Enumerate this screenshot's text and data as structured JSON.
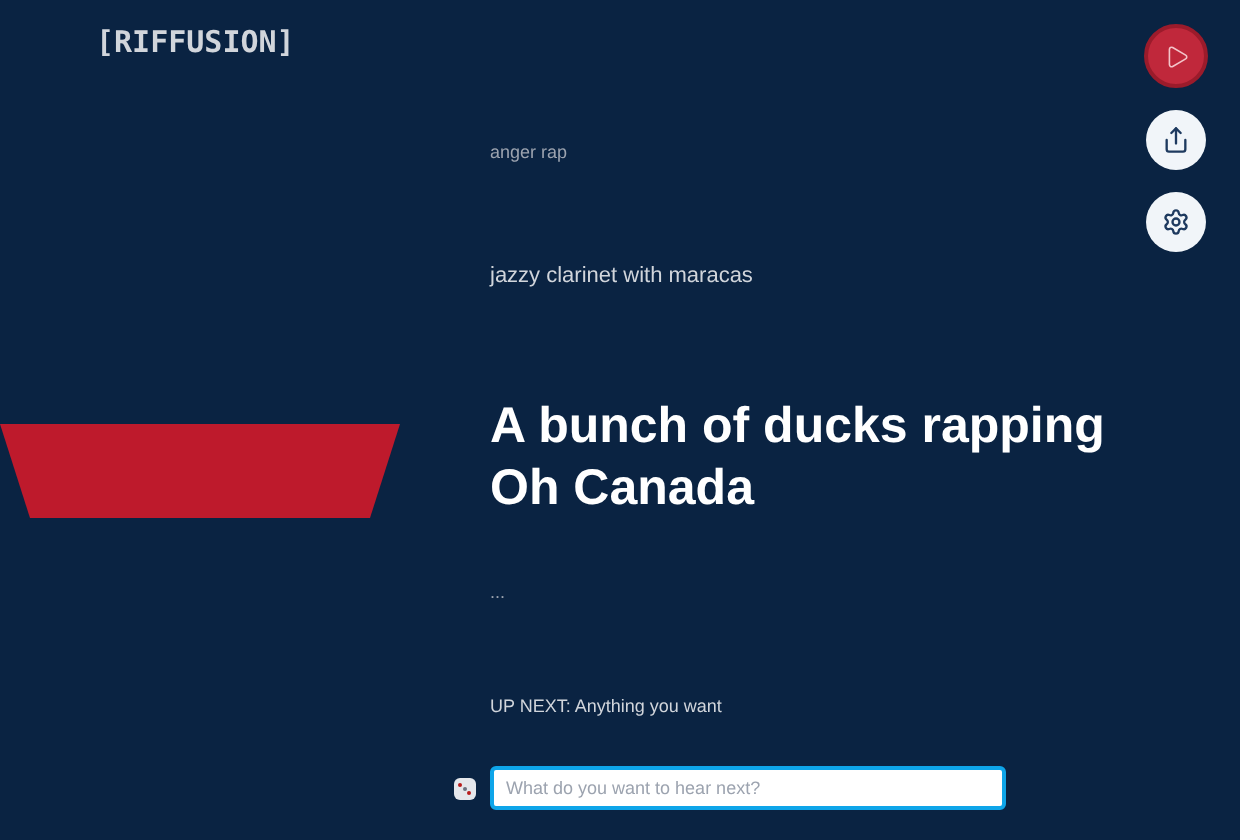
{
  "logo": "[RIFFUSION]",
  "prompts": [
    {
      "text": "anger rap",
      "kind": "past"
    },
    {
      "text": "jazzy clarinet with maracas",
      "kind": "recent"
    },
    {
      "text": "A bunch of ducks rapping Oh Canada",
      "kind": "current"
    },
    {
      "text": "...",
      "kind": "past"
    }
  ],
  "up_next": "UP NEXT: Anything you want",
  "prompt_field": {
    "placeholder": "What do you want to hear next?"
  }
}
